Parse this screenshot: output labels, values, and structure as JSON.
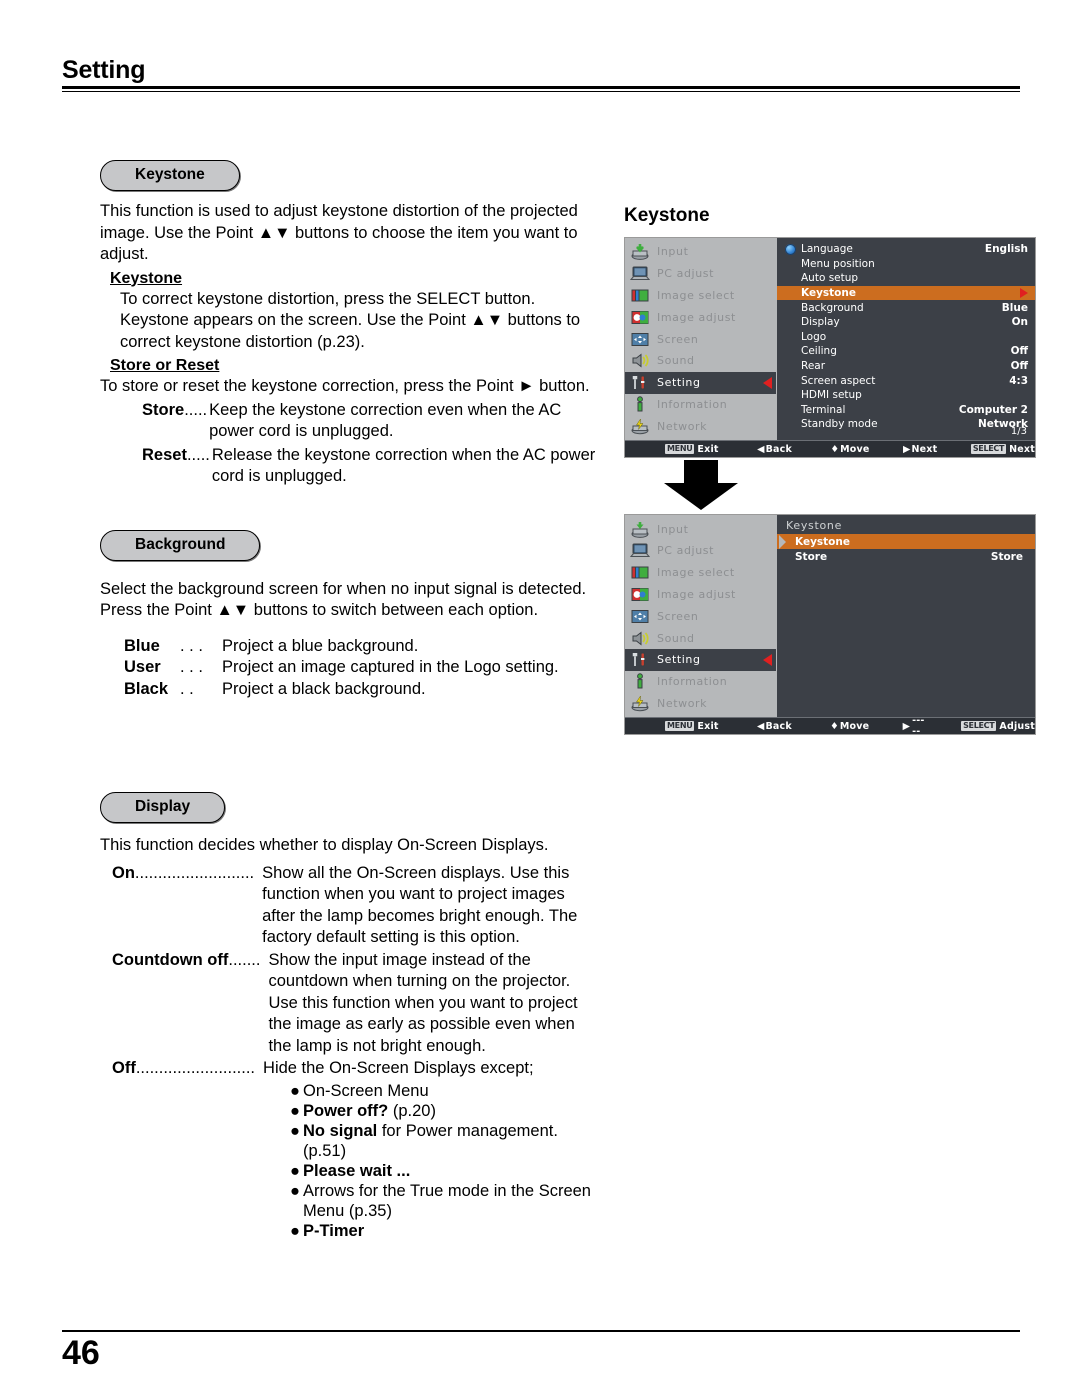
{
  "header": {
    "title": "Setting"
  },
  "footer": {
    "page_number": "46"
  },
  "sections": {
    "keystone": {
      "pill_label": "Keystone",
      "intro": "This function is used to adjust keystone distortion of the projected image. Use the Point ▲▼ buttons to choose the item you want to adjust.",
      "sub1_head": "Keystone",
      "sub1_text": "To correct keystone distortion, press the SELECT button. Keystone appears on the screen. Use the Point ▲▼ buttons to correct keystone distortion (p.23).",
      "sub2_head": "Store or Reset",
      "sub2_text": "To store or reset the keystone correction, press the Point ► button.",
      "items": [
        {
          "term": "Store",
          "dots": " .....",
          "desc": "Keep the keystone correction even when the AC power cord is unplugged."
        },
        {
          "term": "Reset",
          "dots": ".....",
          "desc": "Release the keystone correction when the AC power cord is unplugged."
        }
      ]
    },
    "background": {
      "pill_label": "Background",
      "intro": "Select the background screen for when no input signal is detected. Press the Point ▲▼ buttons to switch between each option.",
      "items": [
        {
          "term": "Blue",
          "dots": " . . .",
          "desc": "Project a blue background."
        },
        {
          "term": "User",
          "dots": " . . .",
          "desc": "Project an image captured in the Logo setting."
        },
        {
          "term": "Black",
          "dots": " . .",
          "desc": "Project a black background."
        }
      ]
    },
    "display": {
      "pill_label": "Display",
      "intro": "This function decides whether to display On-Screen Displays.",
      "items": [
        {
          "term": "On",
          "dots": " ..........................",
          "desc": "Show all the On-Screen displays. Use this function when you want to project images after the lamp becomes bright enough. The factory default setting is this option."
        },
        {
          "term": "Countdown off",
          "dots": " .......",
          "desc": "Show the input image instead of the countdown when turning on the projector. Use this function when you want to project the image as early as possible even when the lamp is not bright enough."
        },
        {
          "term": "Off",
          "dots": " ..........................",
          "desc": "Hide the On-Screen Displays except;"
        }
      ],
      "off_bullets": [
        {
          "bold": "",
          "text": "On-Screen Menu"
        },
        {
          "bold": "Power off?",
          "text": " (p.20)"
        },
        {
          "bold": "No signal",
          "text": " for Power management. (p.51)"
        },
        {
          "bold": "Please wait ...",
          "text": ""
        },
        {
          "bold": "",
          "text": "Arrows for the True mode in the Screen Menu (p.35)"
        },
        {
          "bold": "P-Timer",
          "text": ""
        }
      ]
    }
  },
  "figure": {
    "title": "Keystone",
    "colors": {
      "highlight": "#cc6d1f",
      "panel": "#3c4047",
      "sidebar": "#b6b8ba",
      "arrow_red": "#e02020"
    },
    "sidebar_items": [
      {
        "label": "Input",
        "icon": "input-icon",
        "active": false
      },
      {
        "label": "PC adjust",
        "icon": "pc-adjust-icon",
        "active": false
      },
      {
        "label": "Image select",
        "icon": "image-select-icon",
        "active": false
      },
      {
        "label": "Image adjust",
        "icon": "image-adjust-icon",
        "active": false
      },
      {
        "label": "Screen",
        "icon": "screen-icon",
        "active": false
      },
      {
        "label": "Sound",
        "icon": "sound-icon",
        "active": false
      },
      {
        "label": "Setting",
        "icon": "setting-icon",
        "active": true
      },
      {
        "label": "Information",
        "icon": "information-icon",
        "active": false
      },
      {
        "label": "Network",
        "icon": "network-icon",
        "active": false
      }
    ],
    "osd1": {
      "rows": [
        {
          "label": "Language",
          "value": "English",
          "highlight": false,
          "icon": "globe-icon"
        },
        {
          "label": "Menu position",
          "value": "",
          "highlight": false
        },
        {
          "label": "Auto setup",
          "value": "",
          "highlight": false
        },
        {
          "label": "Keystone",
          "value": "",
          "highlight": true,
          "arrow": true
        },
        {
          "label": "Background",
          "value": "Blue",
          "highlight": false
        },
        {
          "label": "Display",
          "value": "On",
          "highlight": false
        },
        {
          "label": "Logo",
          "value": "",
          "highlight": false
        },
        {
          "label": "Ceiling",
          "value": "Off",
          "highlight": false
        },
        {
          "label": "Rear",
          "value": "Off",
          "highlight": false
        },
        {
          "label": "Screen aspect",
          "value": "4:3",
          "highlight": false
        },
        {
          "label": "HDMI setup",
          "value": "",
          "highlight": false
        },
        {
          "label": "Terminal",
          "value": "Computer 2",
          "highlight": false
        },
        {
          "label": "Standby mode",
          "value": "Network",
          "highlight": false
        }
      ],
      "page_indicator": "1/3",
      "statusbar": [
        {
          "key": "MENU",
          "label": "Exit"
        },
        {
          "key": "◀",
          "label": "Back"
        },
        {
          "key": "♦",
          "label": "Move"
        },
        {
          "key": "▶",
          "label": "Next"
        },
        {
          "key": "SELECT",
          "label": "Next"
        }
      ]
    },
    "osd2": {
      "submenu_title": "Keystone",
      "rows": [
        {
          "label": "Keystone",
          "value": "",
          "highlight": true,
          "caret": true
        },
        {
          "label": "Store",
          "value": "Store",
          "highlight": false
        }
      ],
      "statusbar": [
        {
          "key": "MENU",
          "label": "Exit"
        },
        {
          "key": "◀",
          "label": "Back"
        },
        {
          "key": "♦",
          "label": "Move"
        },
        {
          "key": "▶",
          "label": "-----"
        },
        {
          "key": "SELECT",
          "label": "Adjust"
        }
      ]
    }
  }
}
